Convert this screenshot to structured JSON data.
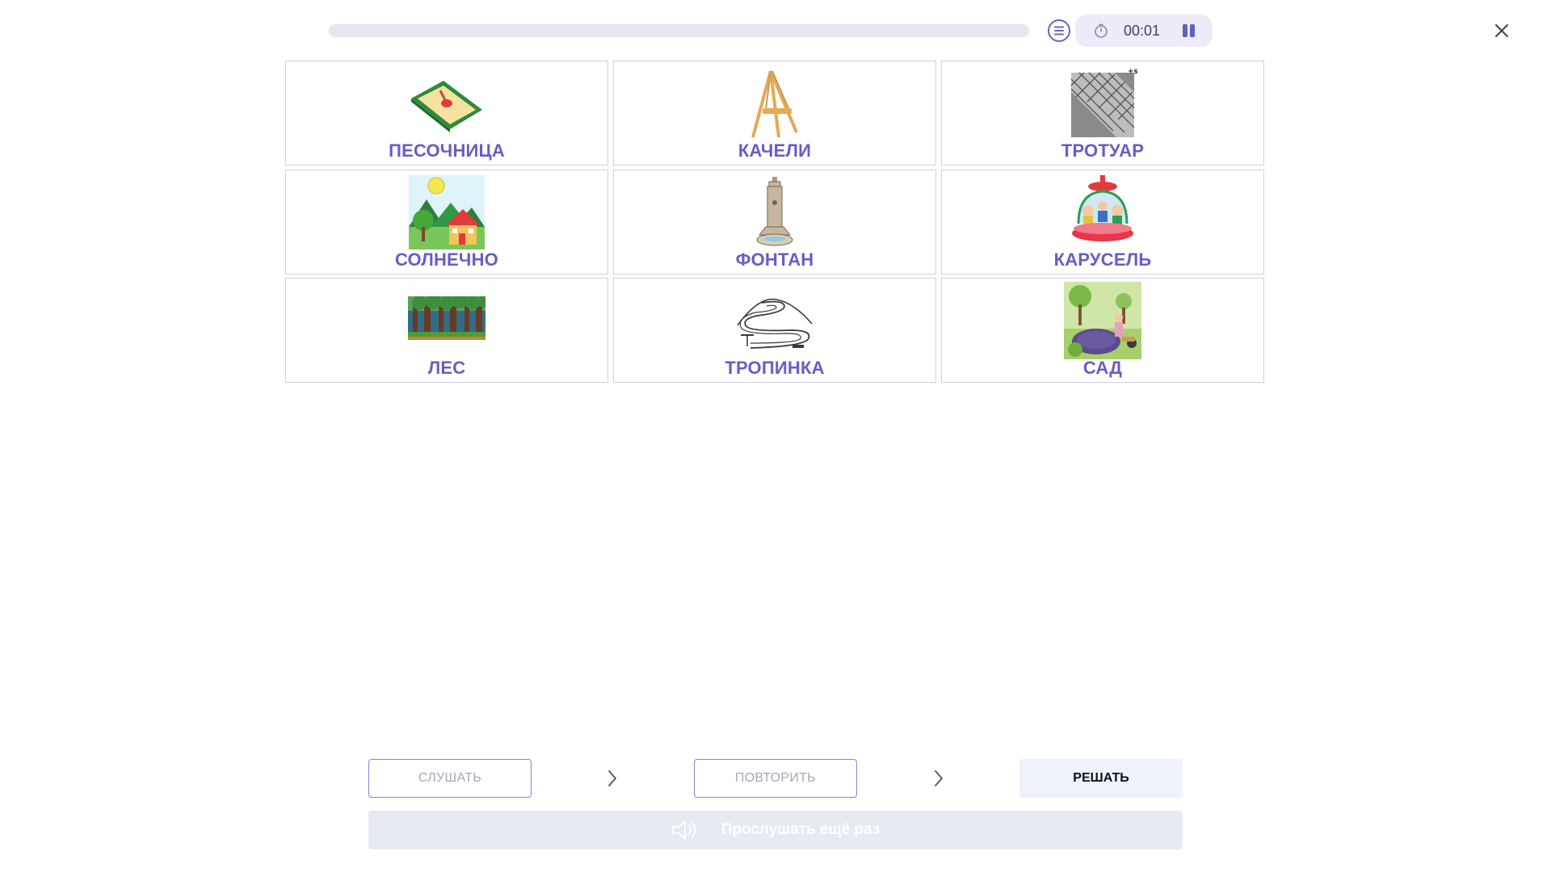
{
  "topbar": {
    "progress_fraction": 0.0,
    "timer": "00:01"
  },
  "colors": {
    "accent": "#6a5cc6",
    "card_border": "#cfcfe6",
    "timer_bg": "#ececf8",
    "solve_bg": "#eef2fb",
    "listen_again_bg": "#e7eaf1"
  },
  "cards": [
    {
      "label": "ПЕСОЧНИЦА",
      "icon": "sandbox-picture"
    },
    {
      "label": "КАЧЕЛИ",
      "icon": "swing-picture"
    },
    {
      "label": "ТРОТУАР",
      "icon": "sidewalk-picture"
    },
    {
      "label": "СОЛНЕЧНО",
      "icon": "sunny-picture"
    },
    {
      "label": "ФОНТАН",
      "icon": "fountain-picture"
    },
    {
      "label": "КАРУСЕЛЬ",
      "icon": "carousel-picture"
    },
    {
      "label": "ЛЕС",
      "icon": "forest-picture"
    },
    {
      "label": "ТРОПИНКА",
      "icon": "path-picture"
    },
    {
      "label": "САД",
      "icon": "garden-picture"
    }
  ],
  "steps": {
    "listen": "СЛУШАТЬ",
    "repeat": "ПОВТОРИТЬ",
    "solve": "РЕШАТЬ"
  },
  "listen_again": "Прослушать ещё раз"
}
